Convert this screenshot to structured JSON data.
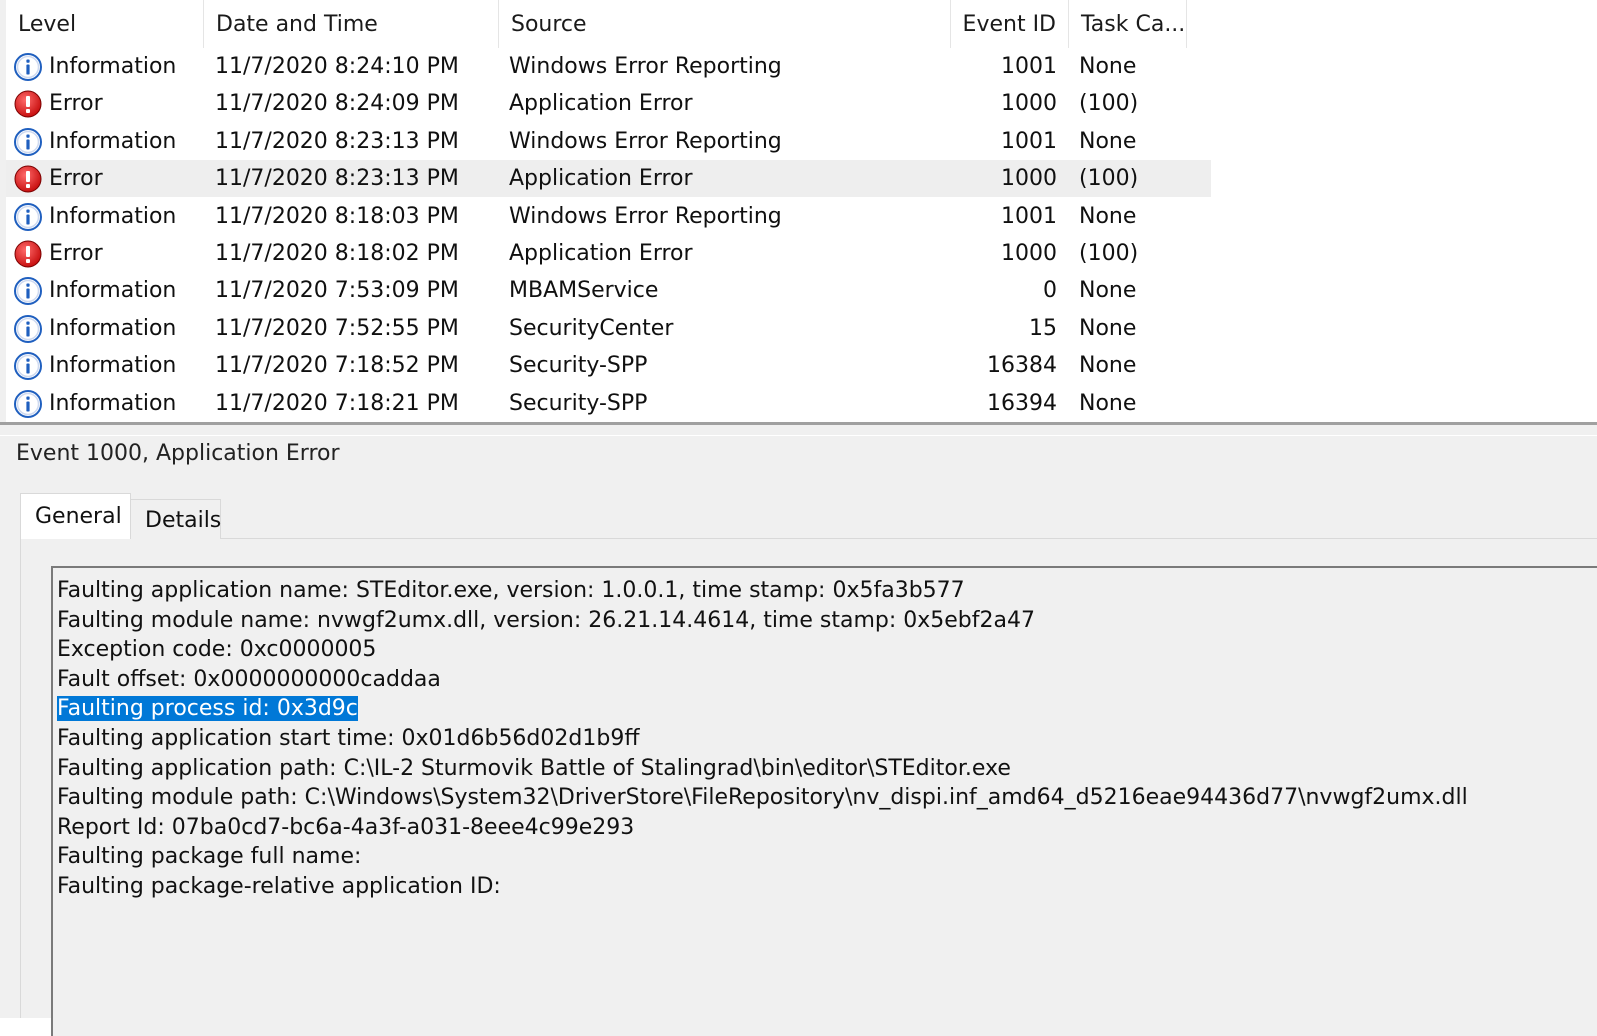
{
  "columns": {
    "level": "Level",
    "date_time": "Date and Time",
    "source": "Source",
    "event_id": "Event ID",
    "task_category": "Task Ca..."
  },
  "events": [
    {
      "level": "Information",
      "icon": "info-icon",
      "date_time": "11/7/2020 8:24:10 PM",
      "source": "Windows Error Reporting",
      "event_id": "1001",
      "task_category": "None"
    },
    {
      "level": "Error",
      "icon": "error-icon",
      "date_time": "11/7/2020 8:24:09 PM",
      "source": "Application Error",
      "event_id": "1000",
      "task_category": "(100)"
    },
    {
      "level": "Information",
      "icon": "info-icon",
      "date_time": "11/7/2020 8:23:13 PM",
      "source": "Windows Error Reporting",
      "event_id": "1001",
      "task_category": "None"
    },
    {
      "level": "Error",
      "icon": "error-icon",
      "date_time": "11/7/2020 8:23:13 PM",
      "source": "Application Error",
      "event_id": "1000",
      "task_category": "(100)",
      "selected": true
    },
    {
      "level": "Information",
      "icon": "info-icon",
      "date_time": "11/7/2020 8:18:03 PM",
      "source": "Windows Error Reporting",
      "event_id": "1001",
      "task_category": "None"
    },
    {
      "level": "Error",
      "icon": "error-icon",
      "date_time": "11/7/2020 8:18:02 PM",
      "source": "Application Error",
      "event_id": "1000",
      "task_category": "(100)"
    },
    {
      "level": "Information",
      "icon": "info-icon",
      "date_time": "11/7/2020 7:53:09 PM",
      "source": "MBAMService",
      "event_id": "0",
      "task_category": "None"
    },
    {
      "level": "Information",
      "icon": "info-icon",
      "date_time": "11/7/2020 7:52:55 PM",
      "source": "SecurityCenter",
      "event_id": "15",
      "task_category": "None"
    },
    {
      "level": "Information",
      "icon": "info-icon",
      "date_time": "11/7/2020 7:18:52 PM",
      "source": "Security-SPP",
      "event_id": "16384",
      "task_category": "None"
    },
    {
      "level": "Information",
      "icon": "info-icon",
      "date_time": "11/7/2020 7:18:21 PM",
      "source": "Security-SPP",
      "event_id": "16394",
      "task_category": "None"
    }
  ],
  "details": {
    "title": "Event 1000, Application Error",
    "tabs": [
      {
        "label": "General",
        "active": true
      },
      {
        "label": "Details",
        "active": false
      }
    ],
    "message_lines": [
      "Faulting application name: STEditor.exe, version: 1.0.0.1, time stamp: 0x5fa3b577",
      "Faulting module name: nvwgf2umx.dll, version: 26.21.14.4614, time stamp: 0x5ebf2a47",
      "Exception code: 0xc0000005",
      "Fault offset: 0x0000000000caddaa",
      "Faulting process id: 0x3d9c",
      "Faulting application start time: 0x01d6b56d02d1b9ff",
      "Faulting application path: C:\\IL-2 Sturmovik Battle of Stalingrad\\bin\\editor\\STEditor.exe",
      "Faulting module path: C:\\Windows\\System32\\DriverStore\\FileRepository\\nv_dispi.inf_amd64_d5216eae94436d77\\nvwgf2umx.dll",
      "Report Id: 07ba0cd7-bc6a-4a3f-a031-8eee4c99e293",
      "Faulting package full name:",
      "Faulting package-relative application ID:"
    ],
    "highlighted_line": 4
  },
  "colors": {
    "info": "#1f5fbf",
    "error": "#c81010",
    "selection": "#0078d7",
    "selected_row": "#eeeeee"
  }
}
